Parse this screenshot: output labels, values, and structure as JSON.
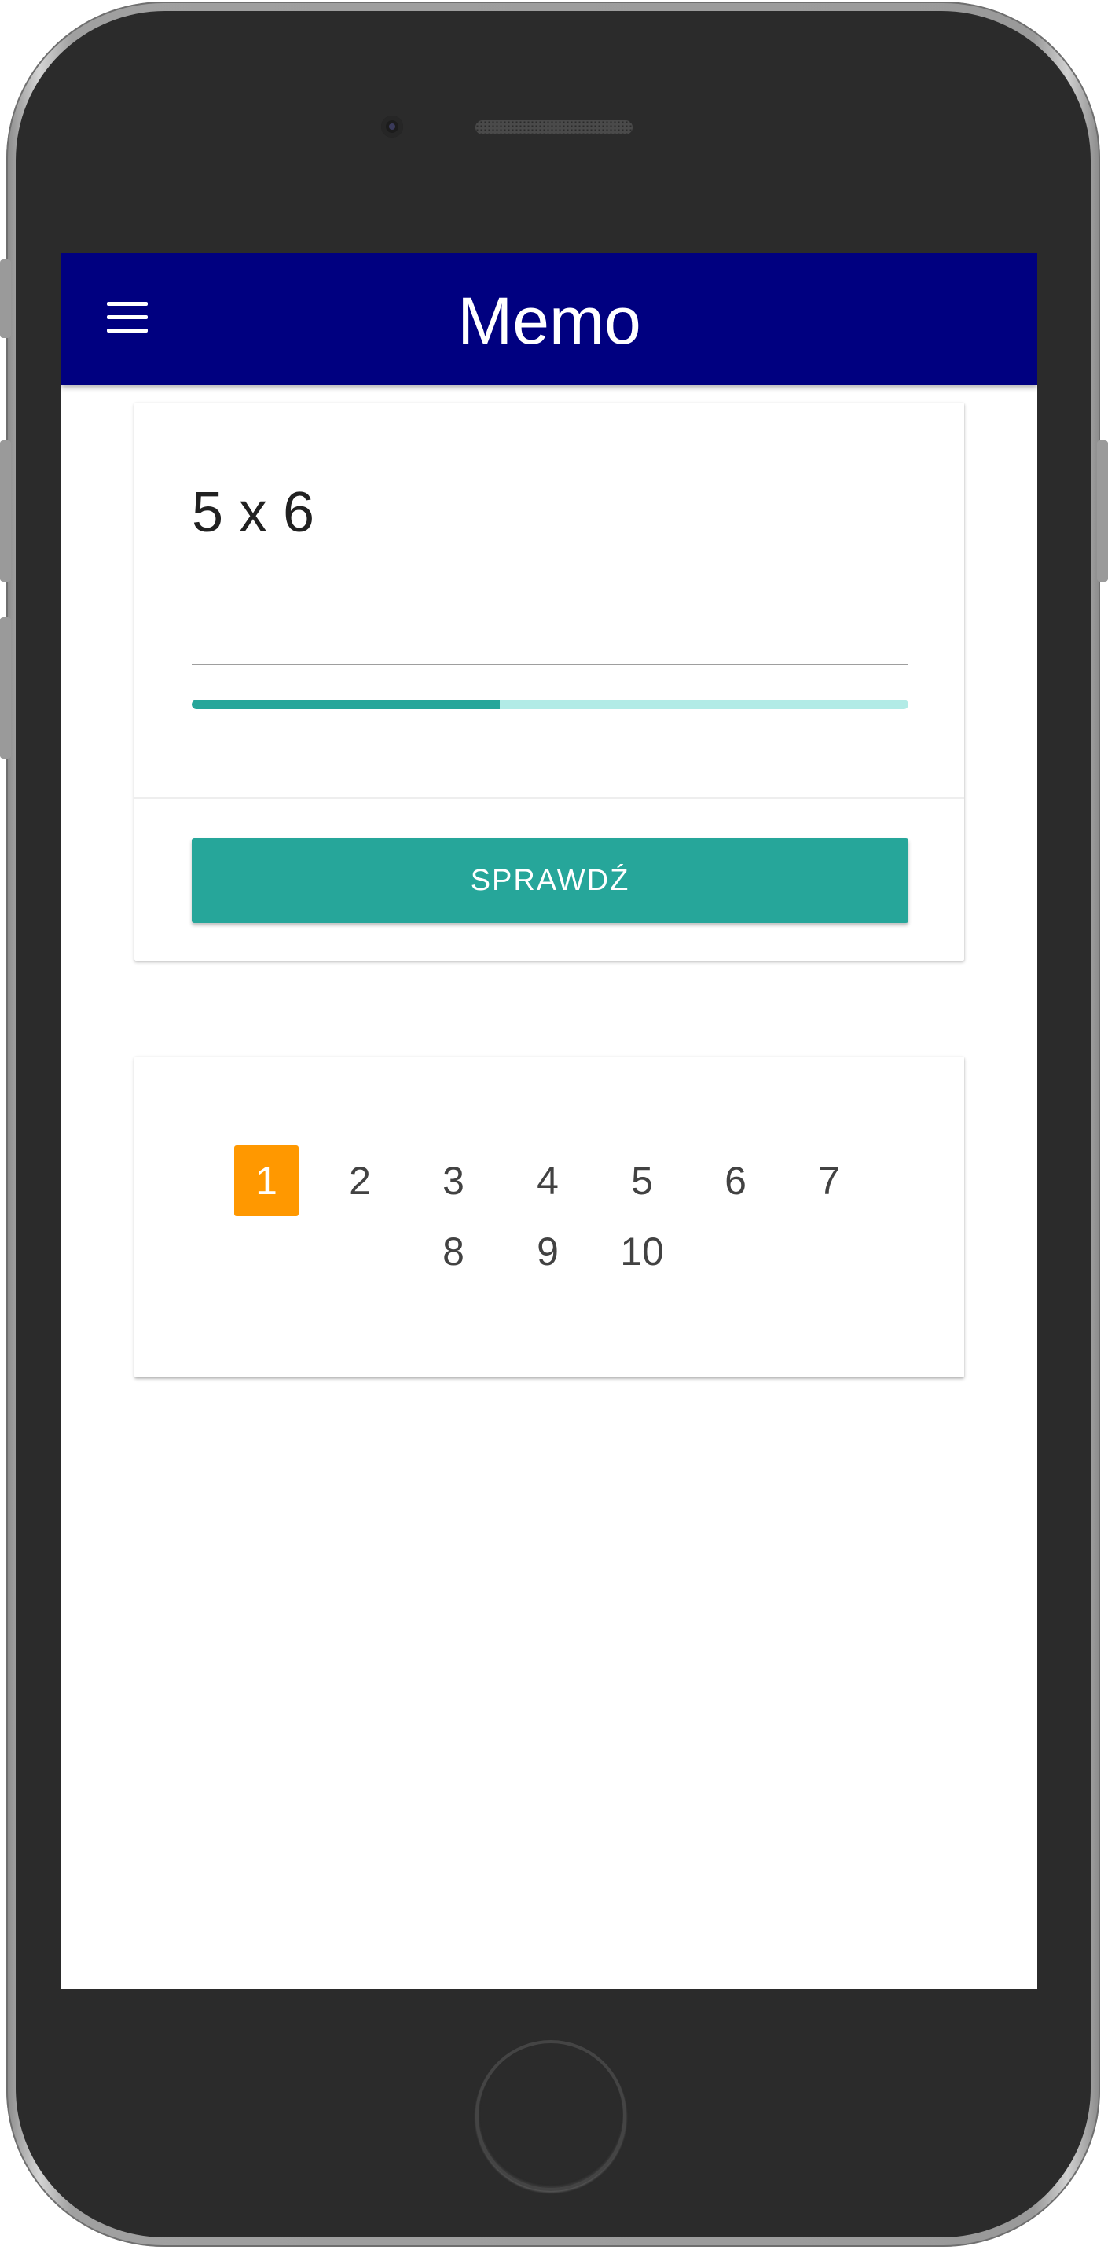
{
  "app": {
    "title": "Memo"
  },
  "exercise": {
    "question": "5 x 6",
    "answer_value": "",
    "progress_fraction": 0.43,
    "check_label": "SPRAWDŹ"
  },
  "pagination": {
    "pages": [
      "1",
      "2",
      "3",
      "4",
      "5",
      "6",
      "7",
      "8",
      "9",
      "10"
    ],
    "active_page": "1"
  },
  "colors": {
    "appbar": "#000080",
    "accent": "#26a69a",
    "progress_track": "#b2ebe6",
    "active_page": "#ff9800"
  },
  "icons": {
    "menu": "menu-icon"
  }
}
